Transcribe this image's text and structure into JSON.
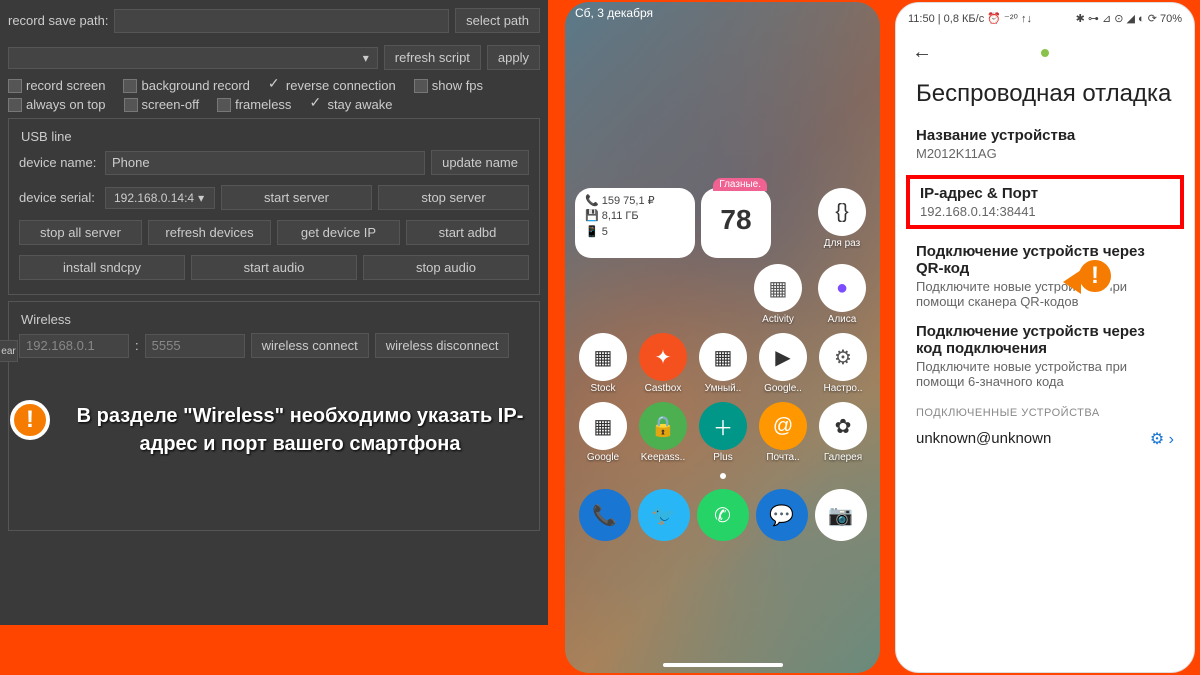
{
  "left": {
    "record_save_path_label": "record save path:",
    "select_path_btn": "select path",
    "refresh_script_btn": "refresh script",
    "apply_btn": "apply",
    "checks": {
      "record_screen": "record screen",
      "background_record": "background record",
      "reverse_connection": "reverse connection",
      "show_fps": "show fps",
      "always_on_top": "always on top",
      "screen_off": "screen-off",
      "frameless": "frameless",
      "stay_awake": "stay awake"
    },
    "usb_title": "USB line",
    "device_name_label": "device name:",
    "device_name_value": "Phone",
    "update_name_btn": "update name",
    "device_serial_label": "device serial:",
    "device_serial_value": "192.168.0.14:4",
    "start_server_btn": "start server",
    "stop_server_btn": "stop server",
    "stop_all_server_btn": "stop all server",
    "refresh_devices_btn": "refresh devices",
    "get_device_ip_btn": "get device IP",
    "start_adbd_btn": "start adbd",
    "install_sndcpy_btn": "install sndcpy",
    "start_audio_btn": "start audio",
    "stop_audio_btn": "stop audio",
    "wireless_title": "Wireless",
    "wireless_ip": "192.168.0.1",
    "wireless_port": "5555",
    "wireless_connect_btn": "wireless connect",
    "wireless_disconnect_btn": "wireless disconnect",
    "ear_btn": "ear",
    "callout_text": "В разделе \"Wireless\" необходимо указать IP-адрес и порт вашего смартфона"
  },
  "mid": {
    "status_date": "Сб, 3 декабря",
    "widget_info": {
      "line1": "📞 159   75,1 ₽",
      "line2": "💾 8,11 ГБ",
      "line3": "📱 5"
    },
    "calendar_badge": "Глазные.",
    "calendar_day": "78",
    "apps_row1": [
      {
        "name": "Для раз",
        "bg": "#fff",
        "fg": "#333",
        "glyph": "{}"
      },
      {
        "name": "Activity",
        "bg": "#fff",
        "fg": "#555",
        "glyph": "▦"
      },
      {
        "name": "Алиса",
        "bg": "#fff",
        "fg": "#7c4dff",
        "glyph": "●"
      }
    ],
    "apps_row2": [
      {
        "name": "Stock",
        "bg": "#fff",
        "fg": "#333",
        "glyph": "▦"
      },
      {
        "name": "Castbox",
        "bg": "#f4511e",
        "fg": "#fff",
        "glyph": "✦"
      },
      {
        "name": "Умный..",
        "bg": "#fff",
        "fg": "#333",
        "glyph": "▦"
      },
      {
        "name": "Google..",
        "bg": "#fff",
        "fg": "#333",
        "glyph": "▶"
      },
      {
        "name": "Настро..",
        "bg": "#fff",
        "fg": "#555",
        "glyph": "⚙"
      }
    ],
    "apps_row3": [
      {
        "name": "Google",
        "bg": "#fff",
        "fg": "#333",
        "glyph": "▦"
      },
      {
        "name": "Keepass..",
        "bg": "#4caf50",
        "fg": "#fff",
        "glyph": "🔒"
      },
      {
        "name": "Plus",
        "bg": "#009688",
        "fg": "#fff",
        "glyph": "＋"
      },
      {
        "name": "Почта..",
        "bg": "#ff9800",
        "fg": "#fff",
        "glyph": "@"
      },
      {
        "name": "Галерея",
        "bg": "#fff",
        "fg": "#333",
        "glyph": "✿"
      }
    ],
    "dock": [
      {
        "bg": "#1976d2",
        "glyph": "📞"
      },
      {
        "bg": "#29b6f6",
        "glyph": "🐦"
      },
      {
        "bg": "#25d366",
        "glyph": "✆"
      },
      {
        "bg": "#1976d2",
        "glyph": "💬"
      },
      {
        "bg": "#fff",
        "glyph": "📷"
      }
    ]
  },
  "right": {
    "status_left": "11:50 | 0,8 КБ/с ⏰ ⁻²⁰ ↑↓",
    "status_right_icons": "✱ ⊶ ⊿ ⊙ ◢ ◐ ⟳ 70%",
    "title": "Беспроводная отладка",
    "device_name_label": "Название устройства",
    "device_name_value": "M2012K11AG",
    "ip_port_label": "IP-адрес & Порт",
    "ip_port_value": "192.168.0.14:38441",
    "qr_title": "Подключение устройств через QR-код",
    "qr_sub": "Подключите новые устройства при помощи сканера QR-кодов",
    "code_title": "Подключение устройств через код подключения",
    "code_sub": "Подключите новые устройства при помощи 6-значного кода",
    "connected_label": "ПОДКЛЮЧЕННЫЕ УСТРОЙСТВА",
    "connected_device": "unknown@unknown"
  }
}
